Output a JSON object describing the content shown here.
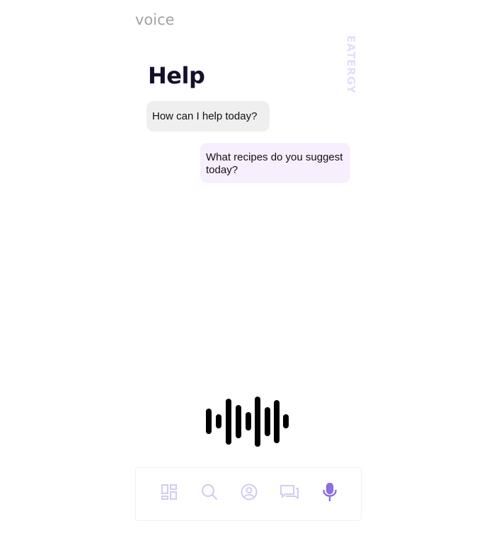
{
  "screen_label": "voice",
  "brand": "EATERGY",
  "page_title": "Help",
  "messages": {
    "assistant": "How can I help today?",
    "user": "What recipes do you suggest today?"
  },
  "nav": {
    "items": [
      {
        "icon": "dashboard-icon",
        "active": false
      },
      {
        "icon": "search-icon",
        "active": false
      },
      {
        "icon": "profile-icon",
        "active": false
      },
      {
        "icon": "chat-icon",
        "active": false
      },
      {
        "icon": "microphone-icon",
        "active": true
      }
    ]
  },
  "colors": {
    "accent": "#8b6fe0",
    "inactive_icon": "#d3cbf3",
    "title": "#13112a",
    "brand": "#e4ddfa",
    "assistant_bubble": "#efefef",
    "user_bubble": "#f8effe",
    "screen_label": "#a3a3a3"
  }
}
